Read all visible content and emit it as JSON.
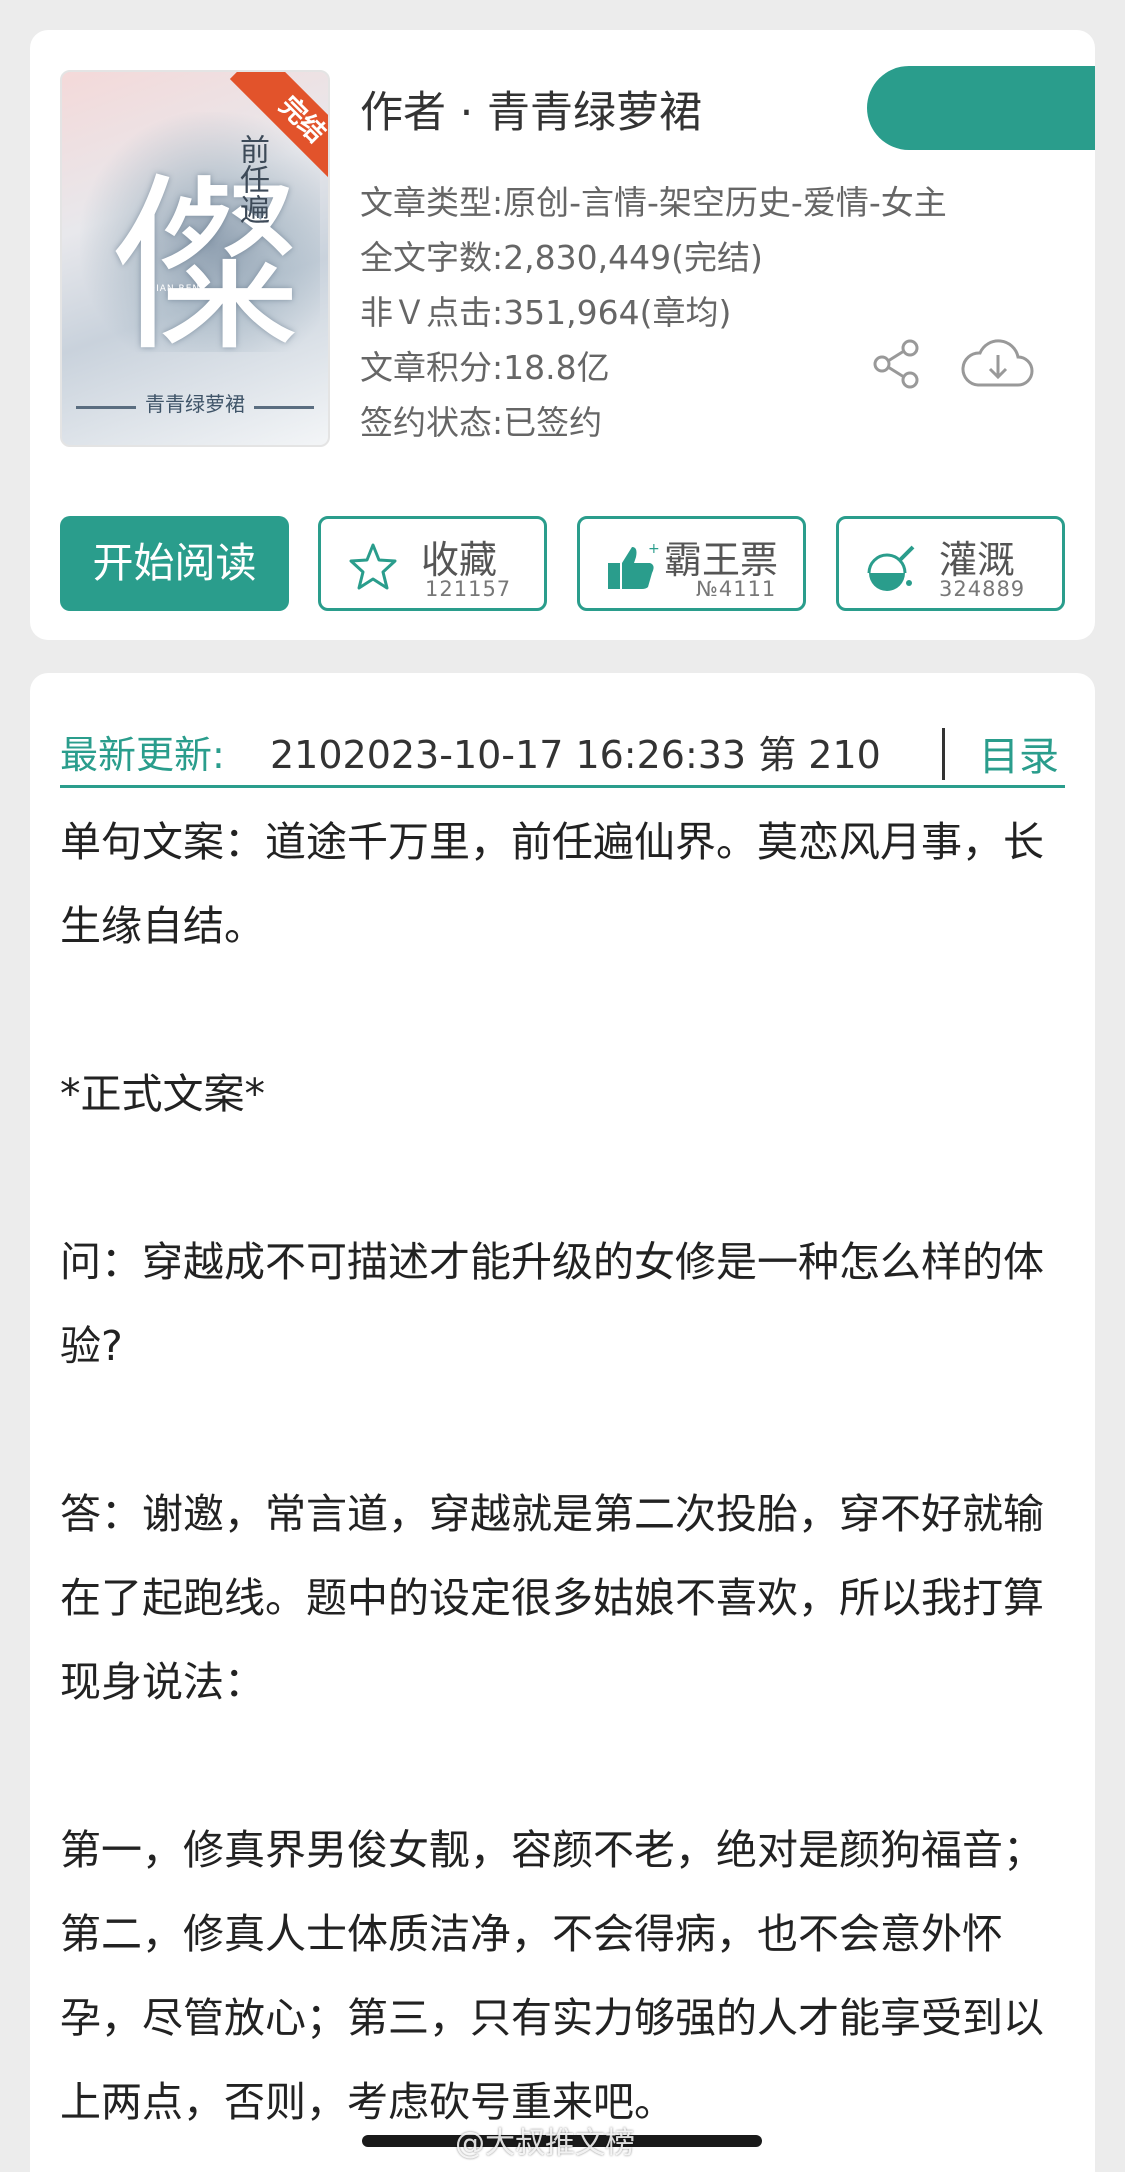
{
  "book": {
    "cover": {
      "big_char": "儏",
      "vertical_title": "前任遍",
      "pinyin": "QIAN REN",
      "author_text": "青青绿萝裙"
    },
    "status_ribbon": "完结",
    "author_line": "作者 · 青青绿萝裙",
    "meta": [
      "文章类型:原创-言情-架空历史-爱情-女主",
      "全文字数:2,830,449(完结)",
      "非Ｖ点击:351,964(章均)",
      "文章积分:18.8亿",
      "签约状态:已签约"
    ]
  },
  "icons": {
    "share": "share-icon",
    "download": "cloud-download-icon",
    "favorite": "star-icon",
    "vote": "thumbs-up-icon",
    "water": "watering-icon"
  },
  "actions": {
    "read_label": "开始阅读",
    "favorite": {
      "label": "收藏",
      "count": "121157"
    },
    "vote": {
      "label": "霸王票",
      "count": "№4111"
    },
    "water": {
      "label": "灌溉",
      "count": "324889"
    }
  },
  "latest": {
    "label": "最新更新:",
    "value": "2102023-10-17 16:26:33   第 210",
    "toc": "目录"
  },
  "content": [
    "单句文案：道途千万里，前任遍仙界。莫恋风月事，长生缘自结。",
    "",
    "*正式文案*",
    "",
    "问：穿越成不可描述才能升级的女修是一种怎么样的体验?",
    "",
    "答：谢邀，常言道，穿越就是第二次投胎，穿不好就输在了起跑线。题中的设定很多姑娘不喜欢，所以我打算现身说法：",
    "",
    "第一，修真界男俊女靓，容颜不老，绝对是颜狗福音；第二，修真人士体质洁净，不会得病，也不会意外怀孕，尽管放心；第三，只有实力够强的人才能享受到以上两点，否则，考虑砍号重来吧。"
  ],
  "watermark": "@大叔推文榜",
  "colors": {
    "accent": "#2a9d8c",
    "ribbon": "#e2532b",
    "background": "#ececec"
  }
}
